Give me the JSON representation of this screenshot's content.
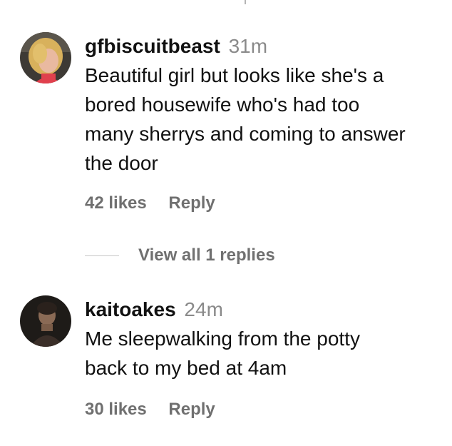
{
  "comments": [
    {
      "username": "gfbiscuitbeast",
      "time": "31m",
      "text_lines": [
        "Beautiful girl but looks like she's a",
        "bored housewife who's had too",
        "many sherrys and coming to answer",
        "the door"
      ],
      "likes": "42 likes",
      "reply": "Reply",
      "view_replies": "View all 1 replies"
    },
    {
      "username": "kaitoakes",
      "time": "24m",
      "text_lines": [
        "Me sleepwalking from the potty",
        "back to my bed at 4am"
      ],
      "likes": "30 likes",
      "reply": "Reply"
    }
  ],
  "colors": {
    "text": "#111111",
    "meta": "#707070",
    "timestamp": "#8a8a8a",
    "divider": "#c7c7c7"
  }
}
